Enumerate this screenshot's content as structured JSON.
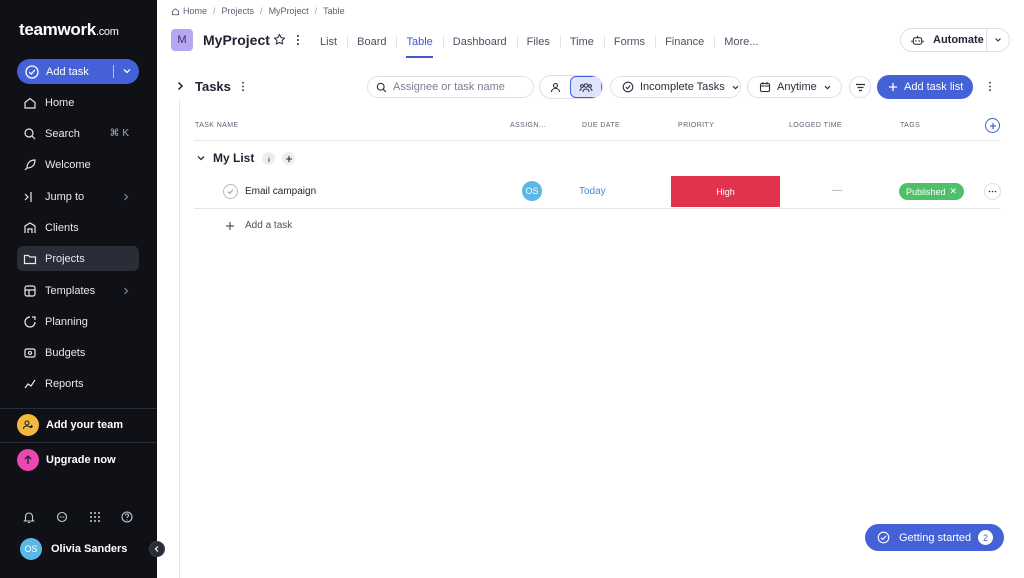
{
  "brand": {
    "name": "teamwork",
    "suffix": ".com"
  },
  "sidebar": {
    "add_task_label": "Add task",
    "items": [
      {
        "label": "Home"
      },
      {
        "label": "Search",
        "shortcut": "⌘ K"
      },
      {
        "label": "Welcome"
      },
      {
        "label": "Jump to"
      },
      {
        "label": "Clients"
      },
      {
        "label": "Projects"
      },
      {
        "label": "Templates"
      },
      {
        "label": "Planning"
      },
      {
        "label": "Budgets"
      },
      {
        "label": "Reports"
      }
    ],
    "add_team_label": "Add your team",
    "upgrade_label": "Upgrade now",
    "user": {
      "initials": "OS",
      "name": "Olivia Sanders"
    }
  },
  "breadcrumb": [
    "Home",
    "Projects",
    "MyProject",
    "Table"
  ],
  "project": {
    "badge": "M",
    "title": "MyProject",
    "tabs": [
      "List",
      "Board",
      "Table",
      "Dashboard",
      "Files",
      "Time",
      "Forms",
      "Finance",
      "More..."
    ],
    "active_tab": "Table",
    "automate_label": "Automate"
  },
  "toolbar": {
    "title": "Tasks",
    "search_placeholder": "Assignee or task name",
    "filter_label": "Incomplete Tasks",
    "date_label": "Anytime",
    "add_list_label": "Add task list"
  },
  "table": {
    "columns": [
      "TASK NAME",
      "ASSIGN...",
      "DUE DATE",
      "PRIORITY",
      "LOGGED TIME",
      "TAGS"
    ],
    "list_name": "My List",
    "tasks": [
      {
        "name": "Email campaign",
        "assignee": "OS",
        "due": "Today",
        "priority": "High",
        "logged": "—",
        "tag": "Published"
      }
    ],
    "add_task_label": "Add a task"
  },
  "getting_started": {
    "label": "Getting started",
    "count": "2"
  },
  "colors": {
    "sidebar_bg": "#0f1117",
    "accent": "#4461d7",
    "priority_high": "#e1334d",
    "tag_green": "#4fc06a",
    "avatar": "#5bb7e8"
  }
}
